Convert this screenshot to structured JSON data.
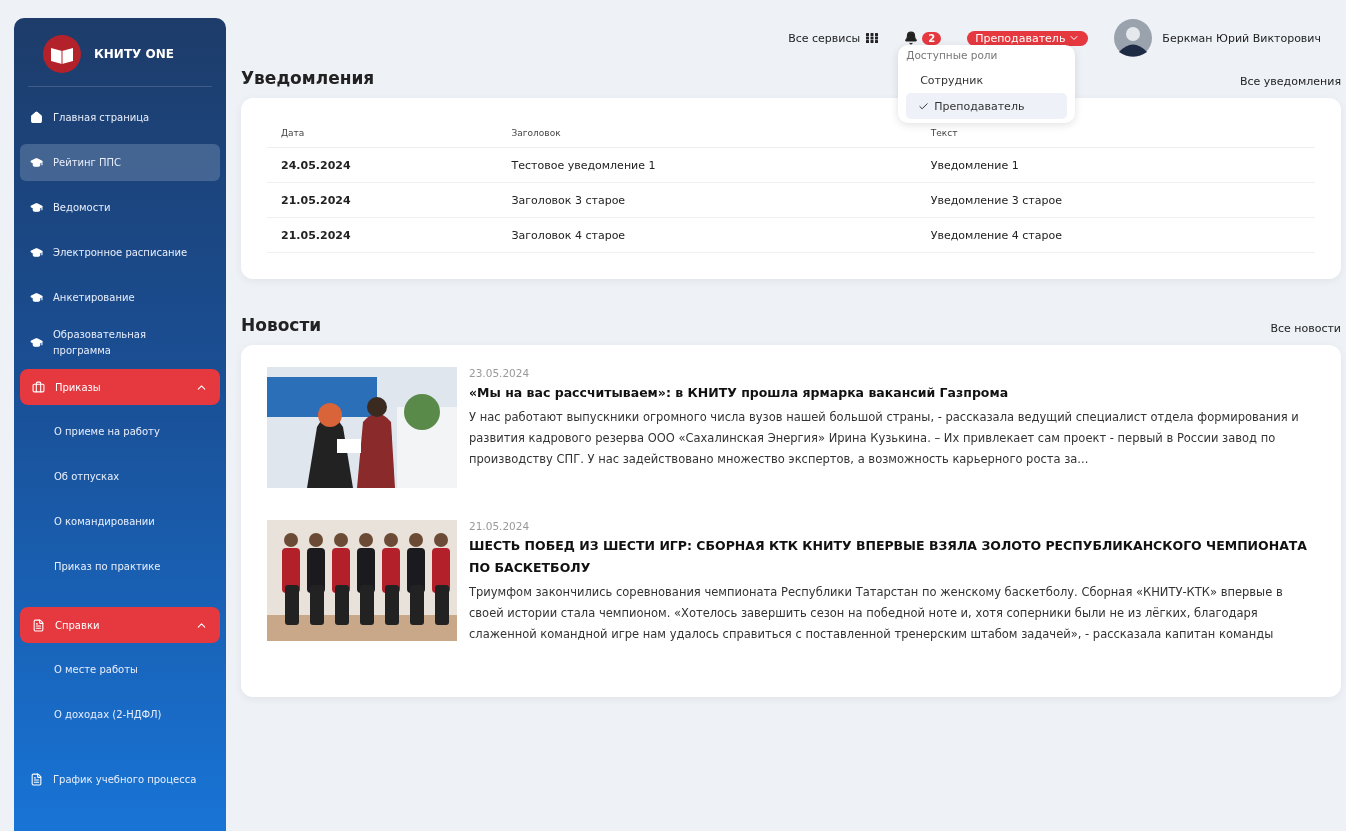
{
  "sidebar": {
    "brand": "КНИТУ ONE",
    "items": [
      {
        "kind": "home",
        "label": "Главная страница",
        "selected": false
      },
      {
        "kind": "course",
        "label": "Рейтинг ППС",
        "selected": true
      },
      {
        "kind": "course",
        "label": "Ведомости",
        "selected": false
      },
      {
        "kind": "course",
        "label": "Электронное расписание",
        "selected": false
      },
      {
        "kind": "course",
        "label": "Анкетирование",
        "selected": false
      },
      {
        "kind": "course",
        "label": "Образовательная программа",
        "selected": false
      },
      {
        "kind": "orders",
        "label": "Приказы",
        "expanded": true,
        "children": [
          {
            "label": "О приеме на работу"
          },
          {
            "label": "Об отпусках"
          },
          {
            "label": "О командировании"
          },
          {
            "label": "Приказ по практике"
          }
        ]
      },
      {
        "kind": "references",
        "label": "Справки",
        "expanded": true,
        "children": [
          {
            "label": "О месте работы"
          },
          {
            "label": "О доходах (2-НДФЛ)"
          }
        ]
      },
      {
        "kind": "document",
        "label": "График учебного процесса",
        "selected": false
      }
    ]
  },
  "header": {
    "services": "Все сервисы",
    "notification_count": "2",
    "role": "Преподаватель",
    "user_name": "Беркман Юрий Викторович",
    "role_menu": {
      "title": "Доступные роли",
      "options": [
        {
          "label": "Сотрудник",
          "selected": false
        },
        {
          "label": "Преподаватель",
          "selected": true
        }
      ]
    }
  },
  "notifications": {
    "title": "Уведомления",
    "link": "Все уведомления",
    "columns": [
      "Дата",
      "Заголовок",
      "Текст"
    ],
    "rows": [
      [
        "24.05.2024",
        "Тестовое уведомление 1",
        "Уведомление 1"
      ],
      [
        "21.05.2024",
        "Заголовок 3 старое",
        "Уведомление 3 старое"
      ],
      [
        "21.05.2024",
        "Заголовок 4 старое",
        "Уведомление 4 старое"
      ]
    ]
  },
  "news": {
    "title": "Новости",
    "link": "Все новости",
    "items": [
      {
        "date": "23.05.2024",
        "title": "«Мы на вас рассчитываем»: в КНИТУ прошла ярмарка вакансий Газпрома",
        "text": "У нас работают выпускники огромного числа вузов нашей большой страны, - рассказала ведущий специалист отдела формирования и развития кадрового резерва ООО «Сахалинская Энергия» Ирина Кузькина. – Их привлекает сам проект - первый в России завод по производству СПГ. У нас задействовано множество экспертов, а возможность карьерного роста за..."
      },
      {
        "date": "21.05.2024",
        "title": "ШЕСТЬ ПОБЕД ИЗ ШЕСТИ ИГР: СБОРНАЯ КТК КНИТУ ВПЕРВЫЕ ВЗЯЛА ЗОЛОТО РЕСПУБЛИКАНСКОГО ЧЕМПИОНАТА ПО БАСКЕТБОЛУ",
        "text": "Триумфом закончились соревнования чемпионата Республики Татарстан по женскому баскетболу. Сборная «КНИТУ-КТК» впервые в своей истории стала чемпионом. «Хотелось завершить сезон на победной ноте и, хотя соперники были не из лёгких, благодаря слаженной командной игре нам удалось справиться с поставленной тренерским штабом задачей», - рассказала капитан команды"
      }
    ]
  }
}
